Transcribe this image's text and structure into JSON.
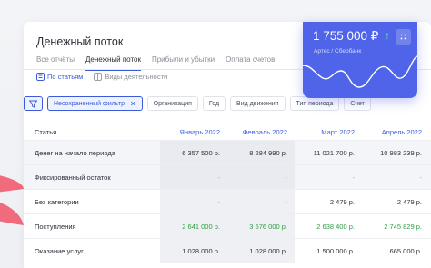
{
  "title": "Денежный поток",
  "tabs": [
    "Все отчёты",
    "Денежный поток",
    "Прибыли и убытки",
    "Оплата счетов"
  ],
  "views": [
    "По статьям",
    "Виды деятельности"
  ],
  "filters": {
    "active": "Несохраненный фильтр",
    "items": [
      "Организация",
      "Год",
      "Вид движения",
      "Тип периода",
      "Счет"
    ]
  },
  "balance": {
    "amount": "1 755 000 ₽",
    "arrow": "↑",
    "subtitle": "Артес / Сбербанк"
  },
  "table": {
    "headers": [
      "Статья",
      "Январь 2022",
      "Февраль 2022",
      "Март 2022",
      "Апрель 2022"
    ],
    "rows": [
      {
        "label": "Денег на начало периода",
        "values": [
          "6 357 500 р.",
          "8 284 990 р.",
          "11 021 700 р.",
          "10 983 239 р."
        ],
        "style": "grey"
      },
      {
        "label": "Фиксированный остаток",
        "values": [
          "-",
          "-",
          "-",
          "-"
        ],
        "style": "grey"
      },
      {
        "label": "Без категории",
        "values": [
          "-",
          "-",
          "2 479 р.",
          "2 479 р."
        ],
        "style": ""
      },
      {
        "label": "Поступления",
        "values": [
          "2 641 000 р.",
          "3 576 000 р.",
          "2 638 400 р.",
          "2 745 829 р."
        ],
        "style": "green"
      },
      {
        "label": "Оказание услуг",
        "values": [
          "1 028 000 р.",
          "1 028 000 р.",
          "1 500 000 р.",
          "665 000 р."
        ],
        "style": ""
      }
    ]
  },
  "colors": {
    "accent": "#3b5bdb",
    "balance_bg": "#4f64e8",
    "positive": "#2f9e44",
    "decor": "#f06c7d"
  }
}
